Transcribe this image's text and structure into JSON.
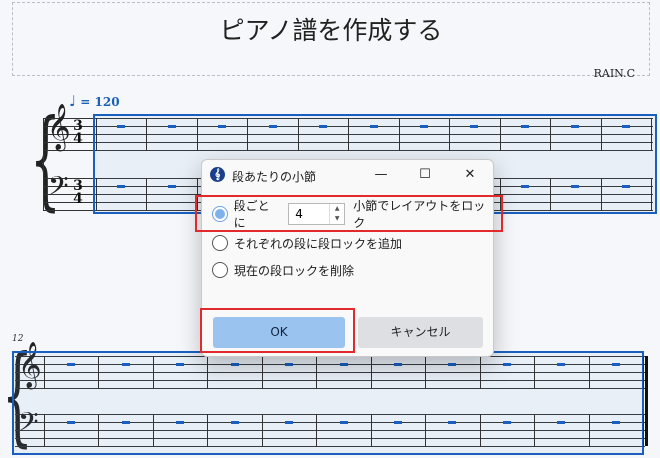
{
  "score": {
    "title": "ピアノ譜を作成する",
    "composer": "RAIN.C",
    "tempo": {
      "note_icon": "quarter-note",
      "value": "= 120"
    },
    "time_signature": {
      "numerator": "3",
      "denominator": "4"
    },
    "second_system_measure_number": "12",
    "accent_color": "#1a5fc0"
  },
  "dialog": {
    "title": "段あたりの小節",
    "icon": "musescore-app-icon",
    "window_controls": {
      "minimize": "—",
      "maximize": "☐",
      "close": "✕"
    },
    "options": [
      {
        "label_before": "段ごとに",
        "value": "4",
        "label_after": "小節でレイアウトをロック",
        "selected": true
      },
      {
        "label": "それぞれの段に段ロックを追加",
        "selected": false
      },
      {
        "label": "現在の段ロックを削除",
        "selected": false
      }
    ],
    "ok_label": "OK",
    "cancel_label": "キャンセル"
  },
  "highlight_color": "#e2292c"
}
